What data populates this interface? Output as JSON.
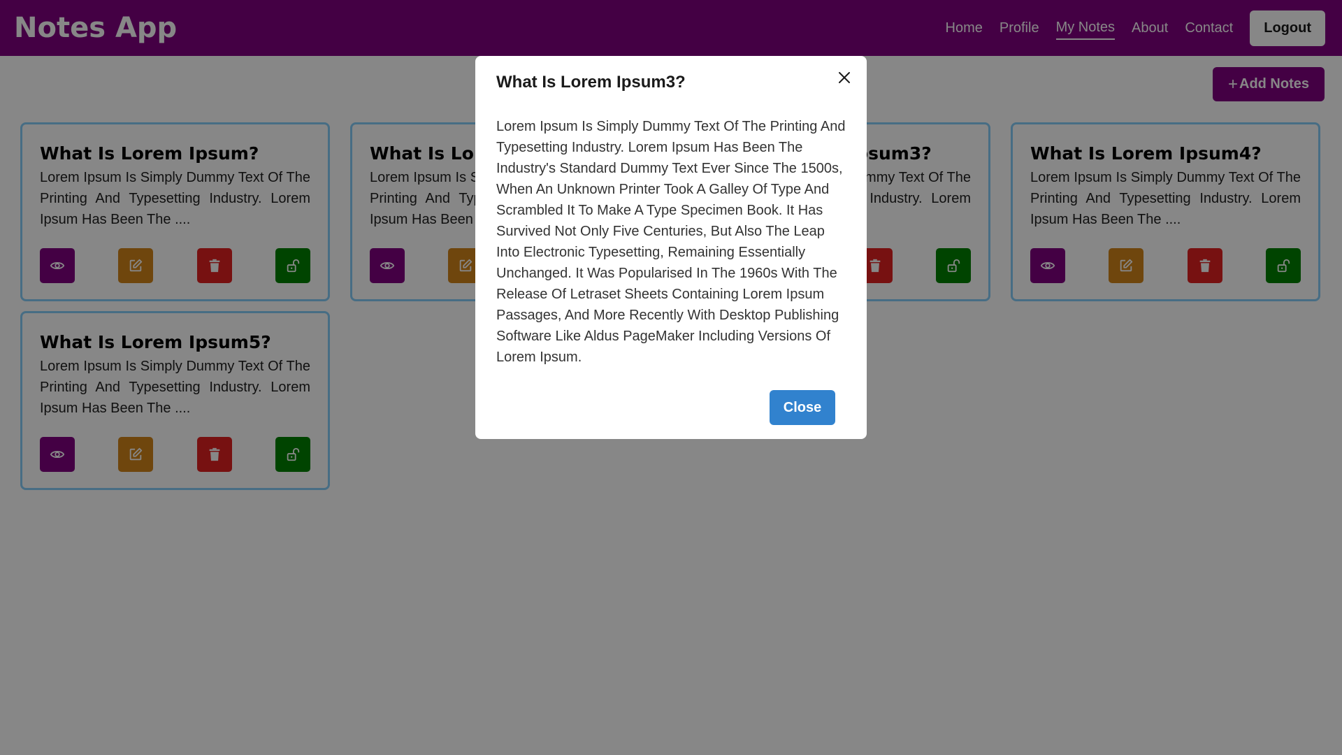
{
  "navbar": {
    "brand": "Notes App",
    "links": [
      "Home",
      "Profile",
      "My Notes",
      "About",
      "Contact"
    ],
    "active_link": "My Notes",
    "logout_label": "Logout"
  },
  "toolbar": {
    "add_notes_label": "Add Notes",
    "add_icon": "plus-icon"
  },
  "notes": [
    {
      "title": "What Is Lorem Ipsum?",
      "excerpt": "Lorem Ipsum Is Simply Dummy Text Of The Printing And Typesetting Industry. Lorem Ipsum Has Been The ...."
    },
    {
      "title": "What Is Lorem Ipsum2?",
      "excerpt": "Lorem Ipsum Is Simply Dummy Text Of The Printing And Typesetting Industry. Lorem Ipsum Has Been The ...."
    },
    {
      "title": "What Is Lorem Ipsum3?",
      "excerpt": "Lorem Ipsum Is Simply Dummy Text Of The Printing And Typesetting Industry. Lorem Ipsum Has Been The ...."
    },
    {
      "title": "What Is Lorem Ipsum4?",
      "excerpt": "Lorem Ipsum Is Simply Dummy Text Of The Printing And Typesetting Industry. Lorem Ipsum Has Been The ...."
    },
    {
      "title": "What Is Lorem Ipsum5?",
      "excerpt": "Lorem Ipsum Is Simply Dummy Text Of The Printing And Typesetting Industry. Lorem Ipsum Has Been The ...."
    }
  ],
  "card_actions": {
    "icons": [
      "eye-icon",
      "edit-icon",
      "trash-icon",
      "unlock-icon"
    ],
    "colors": {
      "view": "#800080",
      "edit": "#d2841a",
      "delete": "#e02020",
      "lock": "#008000"
    }
  },
  "modal": {
    "title": "What Is Lorem Ipsum3?",
    "body": "Lorem Ipsum Is Simply Dummy Text Of The Printing And Typesetting Industry. Lorem Ipsum Has Been The Industry's Standard Dummy Text Ever Since The 1500s, When An Unknown Printer Took A Galley Of Type And Scrambled It To Make A Type Specimen Book. It Has Survived Not Only Five Centuries, But Also The Leap Into Electronic Typesetting, Remaining Essentially Unchanged. It Was Popularised In The 1960s With The Release Of Letraset Sheets Containing Lorem Ipsum Passages, And More Recently With Desktop Publishing Software Like Aldus PageMaker Including Versions Of Lorem Ipsum.",
    "close_label": "Close",
    "close_icon": "close-icon"
  },
  "colors": {
    "navbar": "#800080",
    "accent_button": "#3182ce",
    "card_border": "#87cefa"
  }
}
